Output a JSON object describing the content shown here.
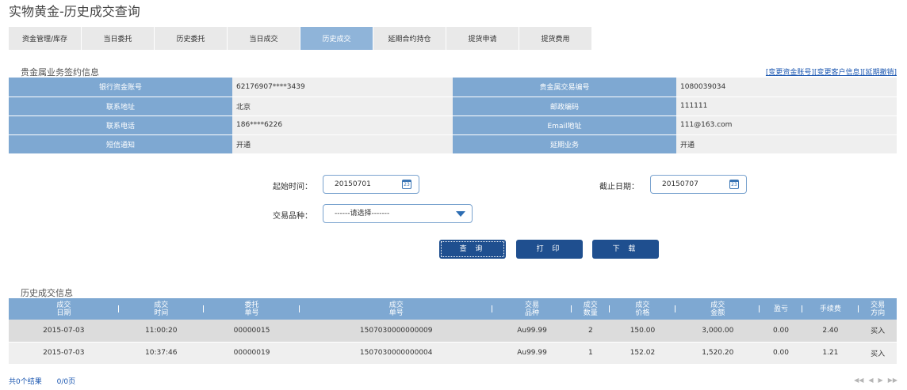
{
  "page_title": "实物黄金-历史成交查询",
  "tabs": [
    {
      "label": "资金管理/库存"
    },
    {
      "label": "当日委托"
    },
    {
      "label": "历史委托"
    },
    {
      "label": "当日成交"
    },
    {
      "label": "历史成交",
      "active": true
    },
    {
      "label": "延期合约持仓"
    },
    {
      "label": "提货申请"
    },
    {
      "label": "提货费用"
    }
  ],
  "sign_info": {
    "title": "贵金属业务签约信息",
    "links": "[变更资金账号][变更客户信息][延期撤销]",
    "rows": [
      {
        "l1": "银行资金账号",
        "v1": "62176907****3439",
        "l2": "贵金属交易编号",
        "v2": "1080039034"
      },
      {
        "l1": "联系地址",
        "v1": "北京",
        "l2": "邮政编码",
        "v2": "111111"
      },
      {
        "l1": "联系电话",
        "v1": "186****6226",
        "l2": "Email地址",
        "v2": "111@163.com"
      },
      {
        "l1": "短信通知",
        "v1": "开通",
        "l2": "延期业务",
        "v2": "开通"
      }
    ]
  },
  "query": {
    "start_label": "起始时间：",
    "start_value": "20150701",
    "end_label": "截止日期：",
    "end_value": "20150707",
    "variety_label": "交易品种：",
    "variety_value": "------请选择-------",
    "calendar_glyph": "23",
    "buttons": {
      "query": "查 询",
      "print": "打 印",
      "download": "下 载"
    }
  },
  "history": {
    "title": "历史成交信息",
    "columns": [
      [
        "成交",
        "日期"
      ],
      [
        "成交",
        "时间"
      ],
      [
        "委托",
        "单号"
      ],
      [
        "成交",
        "单号"
      ],
      [
        "交易",
        "品种"
      ],
      [
        "成交",
        "数量"
      ],
      [
        "成交",
        "价格"
      ],
      [
        "成交",
        "金额"
      ],
      [
        "盈亏",
        ""
      ],
      [
        "手续费",
        ""
      ],
      [
        "交易",
        "方向"
      ]
    ],
    "rows": [
      [
        "2015-07-03",
        "11:00:20",
        "00000015",
        "1507030000000009",
        "Au99.99",
        "2",
        "150.00",
        "3,000.00",
        "0.00",
        "2.40",
        "买入"
      ],
      [
        "2015-07-03",
        "10:37:46",
        "00000019",
        "1507030000000004",
        "Au99.99",
        "1",
        "152.02",
        "1,520.20",
        "0.00",
        "1.21",
        "买入"
      ]
    ]
  },
  "footer": {
    "result_count": "共0个结果",
    "page_info": "0/0页"
  },
  "pager": {
    "first": "◀◀",
    "prev": "◀",
    "next": "▶",
    "last": "▶▶"
  },
  "colors": {
    "header_blue": "#7ea8d2",
    "active_tab": "#8fb4d9",
    "button_navy": "#1f4f8f",
    "link_blue": "#1a56b0"
  }
}
